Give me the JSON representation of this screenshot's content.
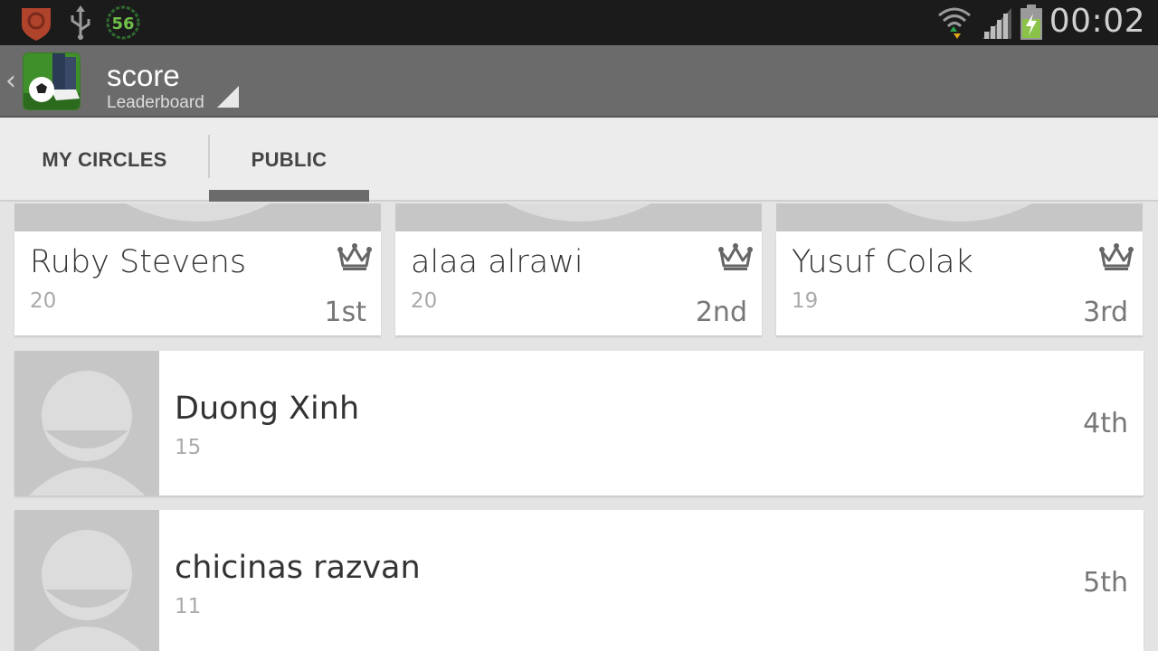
{
  "status_bar": {
    "time": "00:02",
    "battery_label": "56",
    "icons": [
      "shield-icon",
      "usb-icon",
      "battery-level-icon",
      "wifi-icon",
      "signal-icon",
      "battery-charging-icon"
    ]
  },
  "action_bar": {
    "title": "score",
    "subtitle": "Leaderboard"
  },
  "tabs": [
    {
      "label": "MY CIRCLES",
      "selected": false
    },
    {
      "label": "PUBLIC",
      "selected": true
    }
  ],
  "leaders": [
    {
      "name": "Ruby Stevens",
      "score": "20",
      "rank": "1st"
    },
    {
      "name": "alaa alrawi",
      "score": "20",
      "rank": "2nd"
    },
    {
      "name": "Yusuf Colak",
      "score": "19",
      "rank": "3rd"
    }
  ],
  "players": [
    {
      "name": "Duong Xinh",
      "score": "15",
      "rank": "4th"
    },
    {
      "name": "chicinas razvan",
      "score": "11",
      "rank": "5th"
    }
  ],
  "colors": {
    "status_bar_bg": "#1b1b1b",
    "action_bar_bg": "#6b6b6b",
    "tab_bar_bg": "#ececec",
    "tab_indicator": "#6b6b6b",
    "content_bg": "#e4e4e4",
    "card_bg": "#ffffff"
  }
}
